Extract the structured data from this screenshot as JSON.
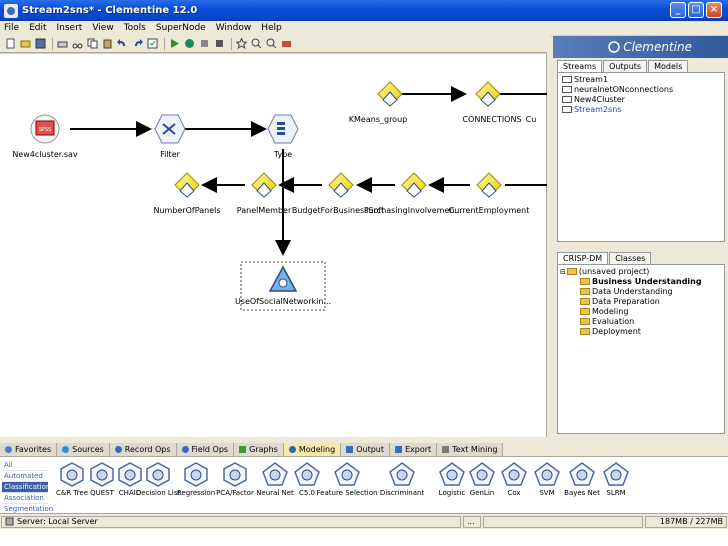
{
  "window": {
    "title": "Stream2sns* - Clementine 12.0"
  },
  "menu": [
    "File",
    "Edit",
    "Insert",
    "View",
    "Tools",
    "SuperNode",
    "Window",
    "Help"
  ],
  "toolbar_icons": [
    "new-icon",
    "open-icon",
    "save-icon",
    "print-icon",
    "cut-icon",
    "copy-icon",
    "paste-icon",
    "undo-icon",
    "redo-icon",
    "properties-icon",
    "execute-icon",
    "execute-selection-icon",
    "pause-icon",
    "stop-icon",
    "annotation-icon",
    "zoom-in-icon",
    "zoom-out-icon",
    "supernode-icon"
  ],
  "canvas": {
    "nodes": [
      {
        "id": "new4cluster",
        "label": "New4cluster.sav",
        "kind": "source"
      },
      {
        "id": "filter",
        "label": "Filter",
        "kind": "filter"
      },
      {
        "id": "type",
        "label": "Type",
        "kind": "type"
      },
      {
        "id": "kmeans",
        "label": "KMeans_group",
        "kind": "model"
      },
      {
        "id": "connections",
        "label": "CONNECTIONS",
        "kind": "model"
      },
      {
        "id": "cut",
        "label": "Cu",
        "kind": "model"
      },
      {
        "id": "numberofpanels",
        "label": "NumberOfPanels",
        "kind": "model"
      },
      {
        "id": "panelmember",
        "label": "PanelMember",
        "kind": "model"
      },
      {
        "id": "budget",
        "label": "BudgetForBusinessSoft",
        "kind": "model"
      },
      {
        "id": "purchasing",
        "label": "PurchasingInvolvemen...",
        "kind": "model"
      },
      {
        "id": "employment",
        "label": "CurrentEmployment",
        "kind": "model"
      },
      {
        "id": "useofsocial",
        "label": "UseOfSocialNetworkin...",
        "kind": "model-selected"
      }
    ]
  },
  "right_panel": {
    "logo": "Clementine",
    "top_tabs": [
      "Streams",
      "Outputs",
      "Models"
    ],
    "streams": [
      "Stream1",
      "neuralnetONconnections",
      "New4Cluster",
      "Stream2sns"
    ],
    "bottom_tabs": [
      "CRISP-DM",
      "Classes"
    ],
    "project_root": "(unsaved project)",
    "project_items": [
      "Business Understanding",
      "Data Understanding",
      "Data Preparation",
      "Modeling",
      "Evaluation",
      "Deployment"
    ]
  },
  "palette_tabs": [
    {
      "label": "Favorites",
      "color": "#4a7fd0"
    },
    {
      "label": "Sources",
      "color": "#3a8ac8"
    },
    {
      "label": "Record Ops",
      "color": "#3a6cc0"
    },
    {
      "label": "Field Ops",
      "color": "#3a6cc0"
    },
    {
      "label": "Graphs",
      "color": "#3a9a3a"
    },
    {
      "label": "Modeling",
      "color": "#2a64c0"
    },
    {
      "label": "Output",
      "color": "#3a6cc0"
    },
    {
      "label": "Export",
      "color": "#3a6cc0"
    },
    {
      "label": "Text Mining",
      "color": "#7a7a7a"
    }
  ],
  "categories": [
    "All",
    "Automated",
    "Classification",
    "Association",
    "Segmentation"
  ],
  "palette_nodes": [
    "C&R Tree",
    "QUEST",
    "CHAID",
    "Decision List",
    "Regression",
    "PCA/Factor",
    "Neural Net",
    "C5.0",
    "Feature Selection",
    "Discriminant",
    "Logistic",
    "GenLin",
    "Cox",
    "SVM",
    "Bayes Net",
    "SLRM"
  ],
  "status": {
    "server": "Server: Local Server",
    "memory": "187MB / 227MB"
  }
}
